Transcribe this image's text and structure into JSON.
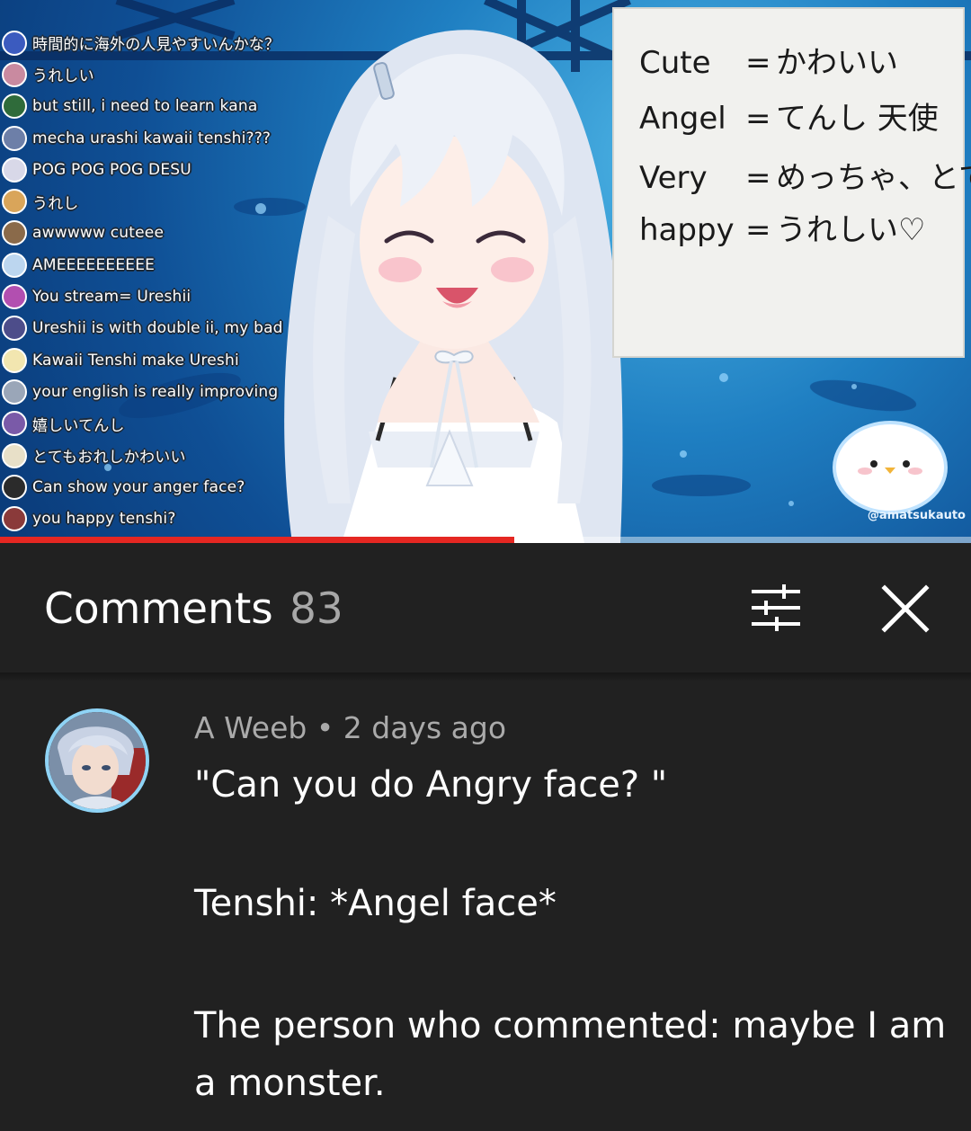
{
  "video": {
    "chat_messages": [
      {
        "text": "時間的に海外の人見やすいんかな？",
        "avatar_color": "#3b5bbf"
      },
      {
        "text": "うれしい",
        "avatar_color": "#c98aa0"
      },
      {
        "text": "but still, i need to learn kana",
        "avatar_color": "#2f6b3a"
      },
      {
        "text": "mecha urashi kawaii tenshi???",
        "avatar_color": "#6d7fa8"
      },
      {
        "text": "POG POG POG DESU",
        "avatar_color": "#d8d8e8"
      },
      {
        "text": "うれし",
        "avatar_color": "#d9a55a"
      },
      {
        "text": "awwwww cuteee",
        "avatar_color": "#8a6a4a"
      },
      {
        "text": "AMEEEEEEEEEE",
        "avatar_color": "#bcd6ef"
      },
      {
        "text": "You stream= Ureshii",
        "avatar_color": "#b24fb0"
      },
      {
        "text": "Ureshii is with double ii, my bad",
        "avatar_color": "#4d4d8a"
      },
      {
        "text": "Kawaii Tenshi make Ureshi",
        "avatar_color": "#f2e6b0"
      },
      {
        "text": "your english is really improving",
        "avatar_color": "#9aa6b8"
      },
      {
        "text": "嬉しいてんし",
        "avatar_color": "#7a5aa8"
      },
      {
        "text": "とてもおれしかわいい",
        "avatar_color": "#e8e0c8"
      },
      {
        "text": "Can show your anger face?",
        "avatar_color": "#2b2b2b"
      },
      {
        "text": "you happy tenshi?",
        "avatar_color": "#8a3a3a"
      }
    ],
    "whiteboard": [
      {
        "term": "Cute",
        "meaning": "かわいい"
      },
      {
        "term": "Angel",
        "meaning": "てんし 天使"
      },
      {
        "term": "Very",
        "meaning": "めっちゃ、とても"
      },
      {
        "term": "happy",
        "meaning": "うれしい♡"
      }
    ],
    "watermark": "@amatsukauto",
    "progress": 0.53,
    "progress_color": "#e52722"
  },
  "comments_panel": {
    "title": "Comments",
    "count": "83",
    "sort_icon": "sort-filter-icon",
    "close_icon": "close-icon"
  },
  "comment": {
    "author": "A Weeb",
    "separator": " • ",
    "time": "2 days ago",
    "lines": [
      "\"Can you do Angry face? \"",
      "Tenshi: *Angel face*",
      "The person who commented: maybe I am",
      "a monster."
    ]
  }
}
